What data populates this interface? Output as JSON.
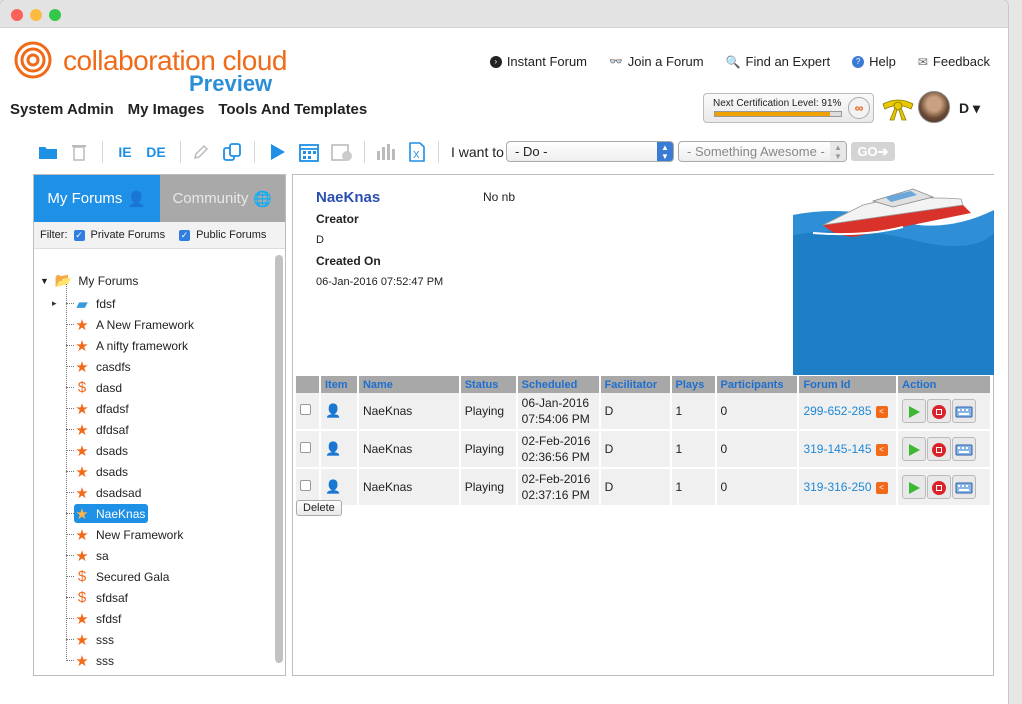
{
  "brand": {
    "name": "collaboration cloud",
    "subtitle": "Preview"
  },
  "topnav": [
    {
      "label": "Instant Forum",
      "icon": "instant-forum-icon"
    },
    {
      "label": "Join a Forum",
      "icon": "join-forum-icon"
    },
    {
      "label": "Find an Expert",
      "icon": "search-icon"
    },
    {
      "label": "Help",
      "icon": "help-icon"
    },
    {
      "label": "Feedback",
      "icon": "envelope-icon"
    }
  ],
  "mainmenu": [
    "System Admin",
    "My Images",
    "Tools And Templates"
  ],
  "certification": {
    "label": "Next Certification Level: 91%",
    "progress": 0.91
  },
  "user": {
    "initial": "D ▾"
  },
  "toolbar": {
    "ie_label": "IE",
    "de_label": "DE",
    "want_label": "I want to",
    "action_select": "- Do -",
    "target_select": "- Something Awesome -",
    "go_label": "GO➔"
  },
  "left_tabs": {
    "active": "My Forums",
    "inactive": "Community"
  },
  "filter": {
    "label": "Filter:",
    "private": "Private Forums",
    "public": "Public Forums"
  },
  "tree": {
    "root": "My Forums",
    "items": [
      {
        "label": "fdsf",
        "type": "folder"
      },
      {
        "label": "A New Framework",
        "type": "star"
      },
      {
        "label": "A nifty framework",
        "type": "star"
      },
      {
        "label": "casdfs",
        "type": "star"
      },
      {
        "label": "dasd",
        "type": "dollar"
      },
      {
        "label": "dfadsf",
        "type": "star"
      },
      {
        "label": "dfdsaf",
        "type": "star"
      },
      {
        "label": "dsads",
        "type": "star"
      },
      {
        "label": "dsads",
        "type": "star"
      },
      {
        "label": "dsadsad",
        "type": "star"
      },
      {
        "label": "NaeKnas",
        "type": "star",
        "selected": true
      },
      {
        "label": "New Framework",
        "type": "star"
      },
      {
        "label": "sa",
        "type": "star"
      },
      {
        "label": "Secured Gala",
        "type": "dollar"
      },
      {
        "label": "sfdsaf",
        "type": "dollar"
      },
      {
        "label": "sfdsf",
        "type": "star"
      },
      {
        "label": "sss",
        "type": "star"
      },
      {
        "label": "sss",
        "type": "star"
      }
    ]
  },
  "detail": {
    "title": "NaeKnas",
    "description": "No nb",
    "creator_label": "Creator",
    "creator": "D",
    "created_label": "Created On",
    "created": "06-Jan-2016 07:52:47 PM"
  },
  "table": {
    "headers": [
      "",
      "Item",
      "Name",
      "Status",
      "Scheduled",
      "Facilitator",
      "Plays",
      "Participants",
      "Forum Id",
      "Action"
    ],
    "rows": [
      {
        "name": "NaeKnas",
        "status": "Playing",
        "date": "06-Jan-2016",
        "time": "07:54:06 PM",
        "facilitator": "D",
        "plays": "1",
        "participants": "0",
        "forum_id": "299-652-285"
      },
      {
        "name": "NaeKnas",
        "status": "Playing",
        "date": "02-Feb-2016",
        "time": "02:36:56 PM",
        "facilitator": "D",
        "plays": "1",
        "participants": "0",
        "forum_id": "319-145-145"
      },
      {
        "name": "NaeKnas",
        "status": "Playing",
        "date": "02-Feb-2016",
        "time": "02:37:16 PM",
        "facilitator": "D",
        "plays": "1",
        "participants": "0",
        "forum_id": "319-316-250"
      }
    ],
    "delete_label": "Delete"
  },
  "colors": {
    "brand_orange": "#f06a1a",
    "accent_blue": "#1e90e6",
    "title_blue": "#2a4fb0"
  }
}
